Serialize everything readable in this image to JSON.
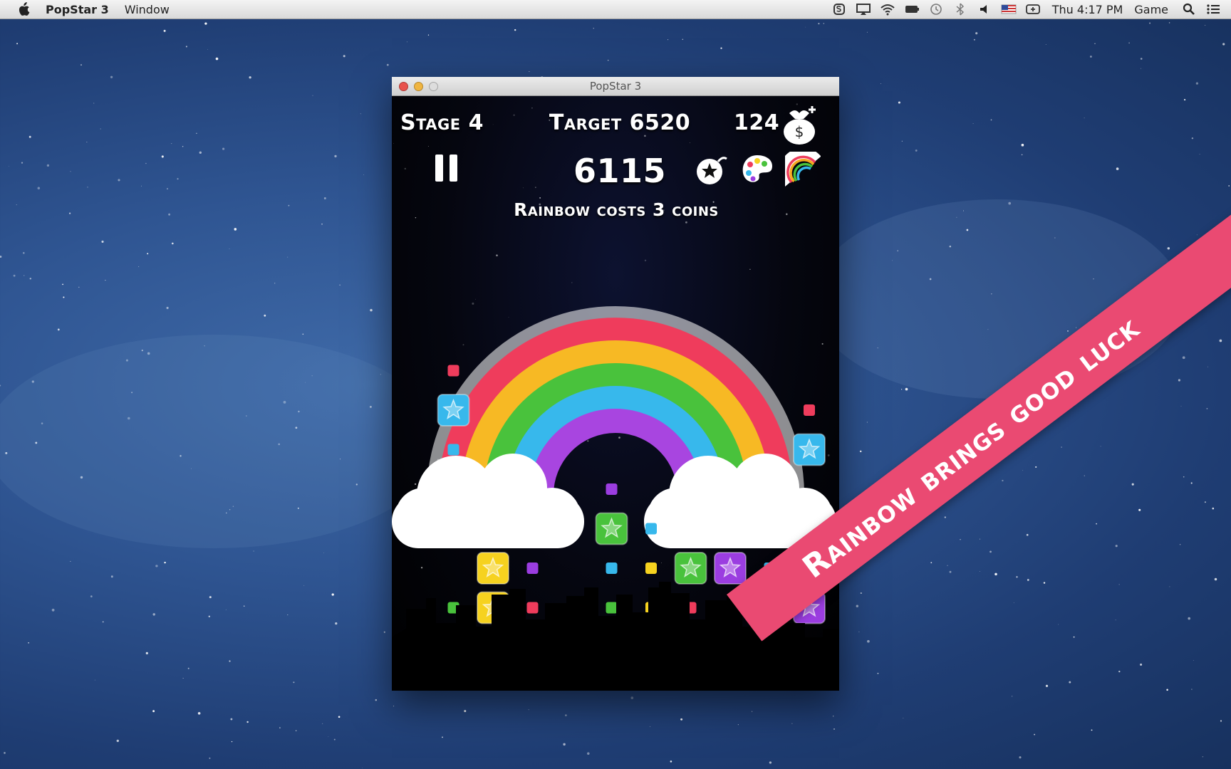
{
  "menubar": {
    "app_name": "PopStar 3",
    "items": [
      "Window"
    ],
    "clock": "Thu 4:17 PM",
    "user": "Game"
  },
  "window": {
    "title": "PopStar 3"
  },
  "hud": {
    "stage": "Stage 4",
    "target": "Target 6520",
    "coins": "124",
    "score": "6115",
    "message": "Rainbow costs 3 coins"
  },
  "tools": [
    {
      "icon": "bomb-icon"
    },
    {
      "icon": "palette-icon"
    },
    {
      "icon": "rainbow-icon"
    }
  ],
  "banner": {
    "text": "Rainbow brings good luck"
  },
  "colors": {
    "red": "#ef3c5c",
    "yellow": "#f6d21f",
    "green": "#49c23c",
    "blue": "#37b8ec",
    "purple": "#9b3de0",
    "banner": "#ea4a72"
  },
  "blocks": [
    {
      "color": "red",
      "size": "small",
      "col": 1,
      "row": -1
    },
    {
      "color": "blue",
      "size": "big",
      "col": 1,
      "row": 0
    },
    {
      "color": "blue",
      "size": "small",
      "col": 1,
      "row": 1
    },
    {
      "color": "red",
      "size": "small",
      "col": 10,
      "row": 0
    },
    {
      "color": "blue",
      "size": "big",
      "col": 10,
      "row": 1
    },
    {
      "color": "purple",
      "size": "small",
      "col": 5,
      "row": 2
    },
    {
      "color": "green",
      "size": "big",
      "col": 5,
      "row": 3
    },
    {
      "color": "blue",
      "size": "small",
      "col": 6,
      "row": 3
    },
    {
      "color": "yellow",
      "size": "big",
      "col": 2,
      "row": 4
    },
    {
      "color": "purple",
      "size": "small",
      "col": 3,
      "row": 4
    },
    {
      "color": "blue",
      "size": "small",
      "col": 5,
      "row": 4
    },
    {
      "color": "yellow",
      "size": "small",
      "col": 6,
      "row": 4
    },
    {
      "color": "green",
      "size": "big",
      "col": 7,
      "row": 4
    },
    {
      "color": "purple",
      "size": "big",
      "col": 8,
      "row": 4
    },
    {
      "color": "blue",
      "size": "small",
      "col": 9,
      "row": 4
    },
    {
      "color": "green",
      "size": "big",
      "col": 10,
      "row": 4
    },
    {
      "color": "green",
      "size": "small",
      "col": 1,
      "row": 5
    },
    {
      "color": "yellow",
      "size": "big",
      "col": 2,
      "row": 5
    },
    {
      "color": "red",
      "size": "small",
      "col": 3,
      "row": 5
    },
    {
      "color": "red",
      "size": "small",
      "col": 4,
      "row": 5
    },
    {
      "color": "green",
      "size": "small",
      "col": 5,
      "row": 5
    },
    {
      "color": "yellow",
      "size": "small",
      "col": 6,
      "row": 5
    },
    {
      "color": "red",
      "size": "small",
      "col": 7,
      "row": 5
    },
    {
      "color": "yellow",
      "size": "small",
      "col": 8,
      "row": 5
    },
    {
      "color": "yellow",
      "size": "big",
      "col": 9,
      "row": 5
    },
    {
      "color": "purple",
      "size": "big",
      "col": 10,
      "row": 5
    },
    {
      "color": "red",
      "size": "small",
      "col": 3,
      "row": 6
    },
    {
      "color": "purple",
      "size": "small",
      "col": 4,
      "row": 6
    },
    {
      "color": "red",
      "size": "small",
      "col": 5,
      "row": 6
    },
    {
      "color": "purple",
      "size": "big",
      "col": 6,
      "row": 6
    },
    {
      "color": "red",
      "size": "small",
      "col": 7,
      "row": 6
    },
    {
      "color": "red",
      "size": "big",
      "col": 9,
      "row": 6
    },
    {
      "color": "purple",
      "size": "small",
      "col": 10,
      "row": 6
    }
  ]
}
